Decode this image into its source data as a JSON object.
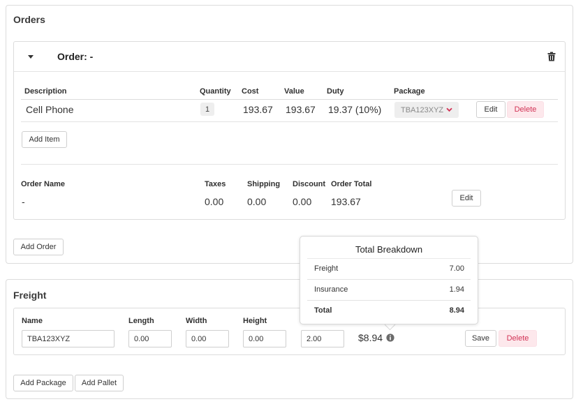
{
  "orders_panel": {
    "title": "Orders",
    "order": {
      "title": "Order: -",
      "items_headers": [
        "Description",
        "Quantity",
        "Cost",
        "Value",
        "Duty",
        "Package"
      ],
      "items": [
        {
          "description": "Cell Phone",
          "quantity": "1",
          "cost": "193.67",
          "value": "193.67",
          "duty": "19.37 (10%)",
          "package": "TBA123XYZ",
          "edit_label": "Edit",
          "delete_label": "Delete"
        }
      ],
      "add_item_label": "Add Item",
      "summary_headers": [
        "Order Name",
        "Taxes",
        "Shipping",
        "Discount",
        "Order Total"
      ],
      "summary": {
        "order_name": "-",
        "taxes": "0.00",
        "shipping": "0.00",
        "discount": "0.00",
        "order_total": "193.67",
        "edit_label": "Edit"
      }
    },
    "add_order_label": "Add Order"
  },
  "freight_panel": {
    "title": "Freight",
    "headers": [
      "Name",
      "Length",
      "Width",
      "Height"
    ],
    "row": {
      "name": "TBA123XYZ",
      "length": "0.00",
      "width": "0.00",
      "height": "0.00",
      "weight": "2.00",
      "total": "$8.94",
      "save_label": "Save",
      "delete_label": "Delete"
    },
    "add_package_label": "Add Package",
    "add_pallet_label": "Add Pallet"
  },
  "breakdown_popover": {
    "title": "Total Breakdown",
    "rows": [
      {
        "label": "Freight",
        "value": "7.00"
      },
      {
        "label": "Insurance",
        "value": "1.94"
      }
    ],
    "total_label": "Total",
    "total_value": "8.94"
  },
  "icons": {
    "collapse": "caret-down-icon",
    "delete_order": "trash-icon",
    "package_dropdown": "chevron-down-icon",
    "info": "info-circle-icon"
  },
  "colors": {
    "danger_text": "#d23255",
    "danger_bg": "#fde8ec",
    "border": "#dcdcdc",
    "chevron_red": "#d23255"
  }
}
